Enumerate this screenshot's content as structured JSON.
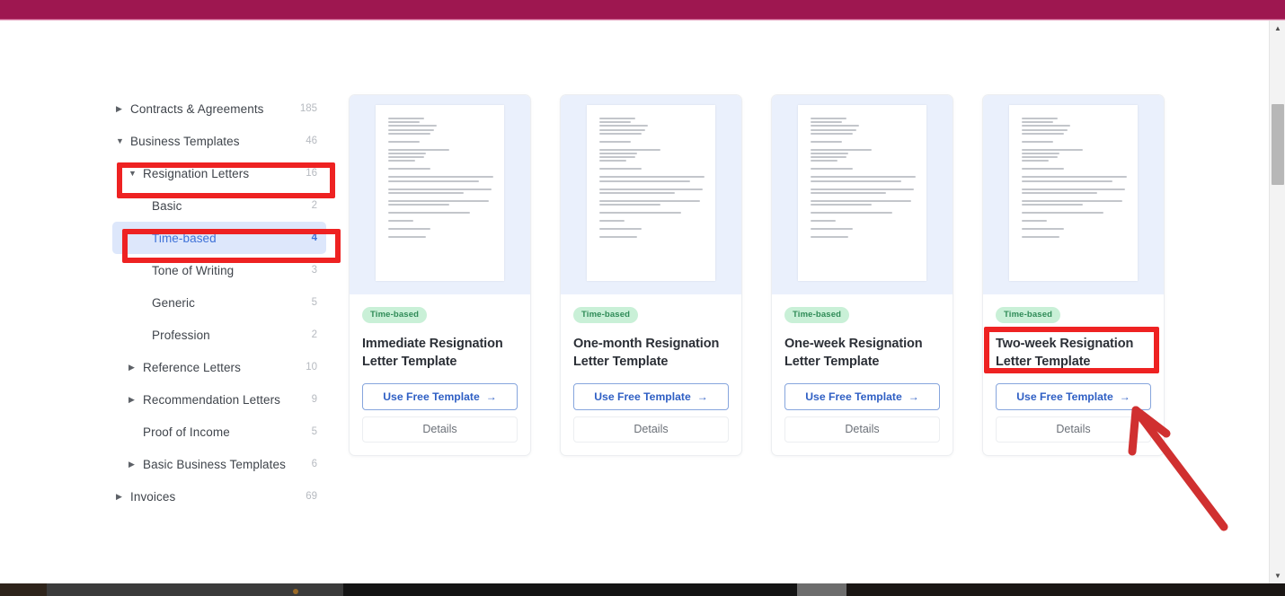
{
  "window": {
    "top_bar_color": "#9e1750",
    "background_color": "#ffffff"
  },
  "sidebar": {
    "items": [
      {
        "label": "Contracts & Agreements",
        "count": "185",
        "level": 0,
        "caret": "collapsed",
        "active": false
      },
      {
        "label": "Business Templates",
        "count": "46",
        "level": 0,
        "caret": "expanded",
        "active": false
      },
      {
        "label": "Resignation Letters",
        "count": "16",
        "level": 1,
        "caret": "expanded",
        "active": false
      },
      {
        "label": "Basic",
        "count": "2",
        "level": 2,
        "caret": "none",
        "active": false
      },
      {
        "label": "Time-based",
        "count": "4",
        "level": 2,
        "caret": "none",
        "active": true
      },
      {
        "label": "Tone of Writing",
        "count": "3",
        "level": 2,
        "caret": "none",
        "active": false
      },
      {
        "label": "Generic",
        "count": "5",
        "level": 2,
        "caret": "none",
        "active": false
      },
      {
        "label": "Profession",
        "count": "2",
        "level": 2,
        "caret": "none",
        "active": false
      },
      {
        "label": "Reference Letters",
        "count": "10",
        "level": 1,
        "caret": "collapsed",
        "active": false
      },
      {
        "label": "Recommendation Letters",
        "count": "9",
        "level": 1,
        "caret": "collapsed",
        "active": false
      },
      {
        "label": "Proof of Income",
        "count": "5",
        "level": 1,
        "caret": "none",
        "active": false
      },
      {
        "label": "Basic Business Templates",
        "count": "6",
        "level": 1,
        "caret": "collapsed",
        "active": false
      },
      {
        "label": "Invoices",
        "count": "69",
        "level": 0,
        "caret": "collapsed",
        "active": false
      }
    ],
    "caret_expanded_glyph": "▼",
    "caret_collapsed_glyph": "▶",
    "active_bg_color": "#dde7fb",
    "active_text_color": "#3f72d8"
  },
  "cards": [
    {
      "tag": "Time-based",
      "title": "Immediate Resignation Letter Template",
      "primary_label": "Use Free Template",
      "primary_arrow": "→",
      "secondary_label": "Details",
      "highlighted": false
    },
    {
      "tag": "Time-based",
      "title": "One-month Resignation Letter Template",
      "primary_label": "Use Free Template",
      "primary_arrow": "→",
      "secondary_label": "Details",
      "highlighted": false
    },
    {
      "tag": "Time-based",
      "title": "One-week Resignation Letter Template",
      "primary_label": "Use Free Template",
      "primary_arrow": "→",
      "secondary_label": "Details",
      "highlighted": false
    },
    {
      "tag": "Time-based",
      "title": "Two-week Resignation Letter Template",
      "primary_label": "Use Free Template",
      "primary_arrow": "→",
      "secondary_label": "Details",
      "highlighted": true
    }
  ],
  "annotations": {
    "color": "#ee2222",
    "boxes": [
      {
        "target": "Resignation Letters sidebar row"
      },
      {
        "target": "Time-based sidebar row"
      },
      {
        "target": "Two-week Resignation Letter Template title"
      }
    ],
    "arrow": {
      "points_to": "Use Free Template button on Two-week card"
    }
  },
  "scrollbar": {
    "up_glyph": "▲",
    "down_glyph": "▼",
    "thumb_color": "#b7b7b7"
  }
}
